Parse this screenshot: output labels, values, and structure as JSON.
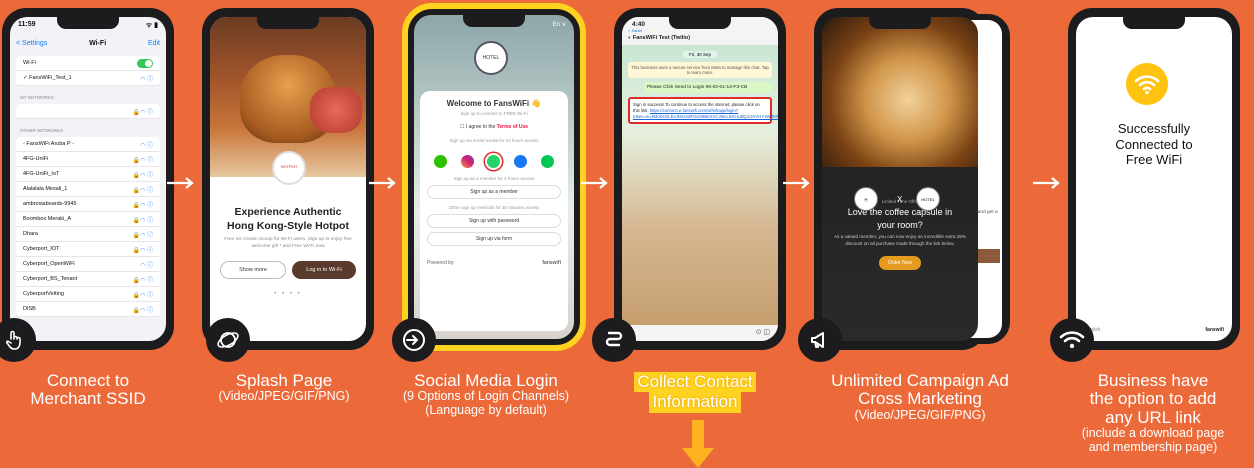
{
  "steps": [
    {
      "title_l1": "Connect to",
      "title_l2": "Merchant SSID"
    },
    {
      "title": "Splash Page",
      "sub": "(Video/JPEG/GIF/PNG)"
    },
    {
      "title": "Social Media Login",
      "sub1": "(9 Options of Login Channels)",
      "sub2": "(Language by default)"
    },
    {
      "title_l1": "Collect Contact",
      "title_l2": "Information"
    },
    {
      "title_l1": "Unlimited Campaign Ad",
      "title_l2": "Cross Marketing",
      "sub": "(Video/JPEG/GIF/PNG)"
    },
    {
      "title_l1": "Business have",
      "title_l2": "the option to add",
      "title_l3": "any URL link",
      "sub1": "(include a download page",
      "sub2": "and membership page)"
    }
  ],
  "screen1": {
    "time": "11:59",
    "back": "< Settings",
    "title": "Wi-Fi",
    "edit": "Edit",
    "wifi_label": "Wi-Fi",
    "connected": "FansWiFi_Test_1",
    "my_networks": "MY NETWORKS",
    "other_networks": "OTHER NETWORKS",
    "networks": [
      "- FansWiFi Aruba P -",
      "4FG-UniFi",
      "4FG-UniFi_IoT",
      "Alalalala Mesali_1",
      "ambrosiaboards-9945",
      "Boombox Meraki_A",
      "Dhara",
      "Cyberport_IOT",
      "Cyberport_OpenWiFi",
      "Cyberport_BS_Tenant",
      "CyberportVetting",
      "DISB"
    ]
  },
  "screen2": {
    "logo": "HOTPOT",
    "heading_l1": "Experience Authentic",
    "heading_l2": "Hong Kong-Style Hotpot",
    "desc": "Free Ice Cream Scoop for Wi-Fi users. Sign up to enjoy free welcome gift * and Free Wi-Fi now",
    "show_more": "Show more",
    "login": "Log in to Wi-Fi",
    "dots": "• • • •"
  },
  "screen3": {
    "lang": "En ∨",
    "logo": "HOTEL",
    "welcome": "Welcome to FansWiFi 👋",
    "signup_free": "Sign up to connect to FREE Wi-Fi",
    "agree": "I agree to the",
    "terms": "Terms of Use",
    "social_note": "Sign up via social media for 24 hours access",
    "member_note": "Sign up as a member for 4 hours access",
    "member_btn": "Sign up as a member",
    "other_note": "Other sign up methods for 30 minutes access",
    "password_btn": "Sign up with password",
    "form_btn": "Sign up via form",
    "powered": "Powered by:",
    "brand": "fanswifi"
  },
  "screen4": {
    "time": "4:40",
    "back": "< Safari",
    "contact": "FansWiFi Test (Twilio)",
    "date": "Fri, 30 Sep",
    "notice": "This business uses a secure service from Meta to manage this chat. Tap to learn more.",
    "request": "Please Click Send to Login 96-02-01-14-F3-CB",
    "reply": "Sign in success! To continue to access the internet, please click on this link:",
    "link": "https://connect.e.fanswifi.com/wf/whapp/login?token=eu.BdoDcOLExJNXzvdFGsOB8eXVCJ8eu.BiGJu8QJcOrVHY3WdMfM5S8W0kNHcadGIJHHmHhk5ZxZ"
  },
  "screen5": {
    "limited": "Limited Time Offer",
    "headline_l1": "Love the coffee capsule in",
    "headline_l2": "your room?",
    "desc": "As a valued member, you can now enjoy an incredible extra 25% discount on all purchase made through the link below.",
    "order": "Order Now",
    "x": "X",
    "back_text": "ree",
    "back_small": "stomers, and get a rt of",
    "hotel": "HOTEL"
  },
  "screen6": {
    "msg_l1": "Successfully",
    "msg_l2": "Connected to",
    "msg_l3": "Free WiFi",
    "lang": "English",
    "brand": "fanswifi"
  },
  "colors": {
    "background": "#ec6a3a",
    "highlight": "#ffd21f",
    "arrow": "#ffffff"
  },
  "icons": [
    "tap-hand-icon",
    "globe-icon",
    "login-icon",
    "route-icon",
    "megaphone-icon",
    "wifi-icon"
  ]
}
